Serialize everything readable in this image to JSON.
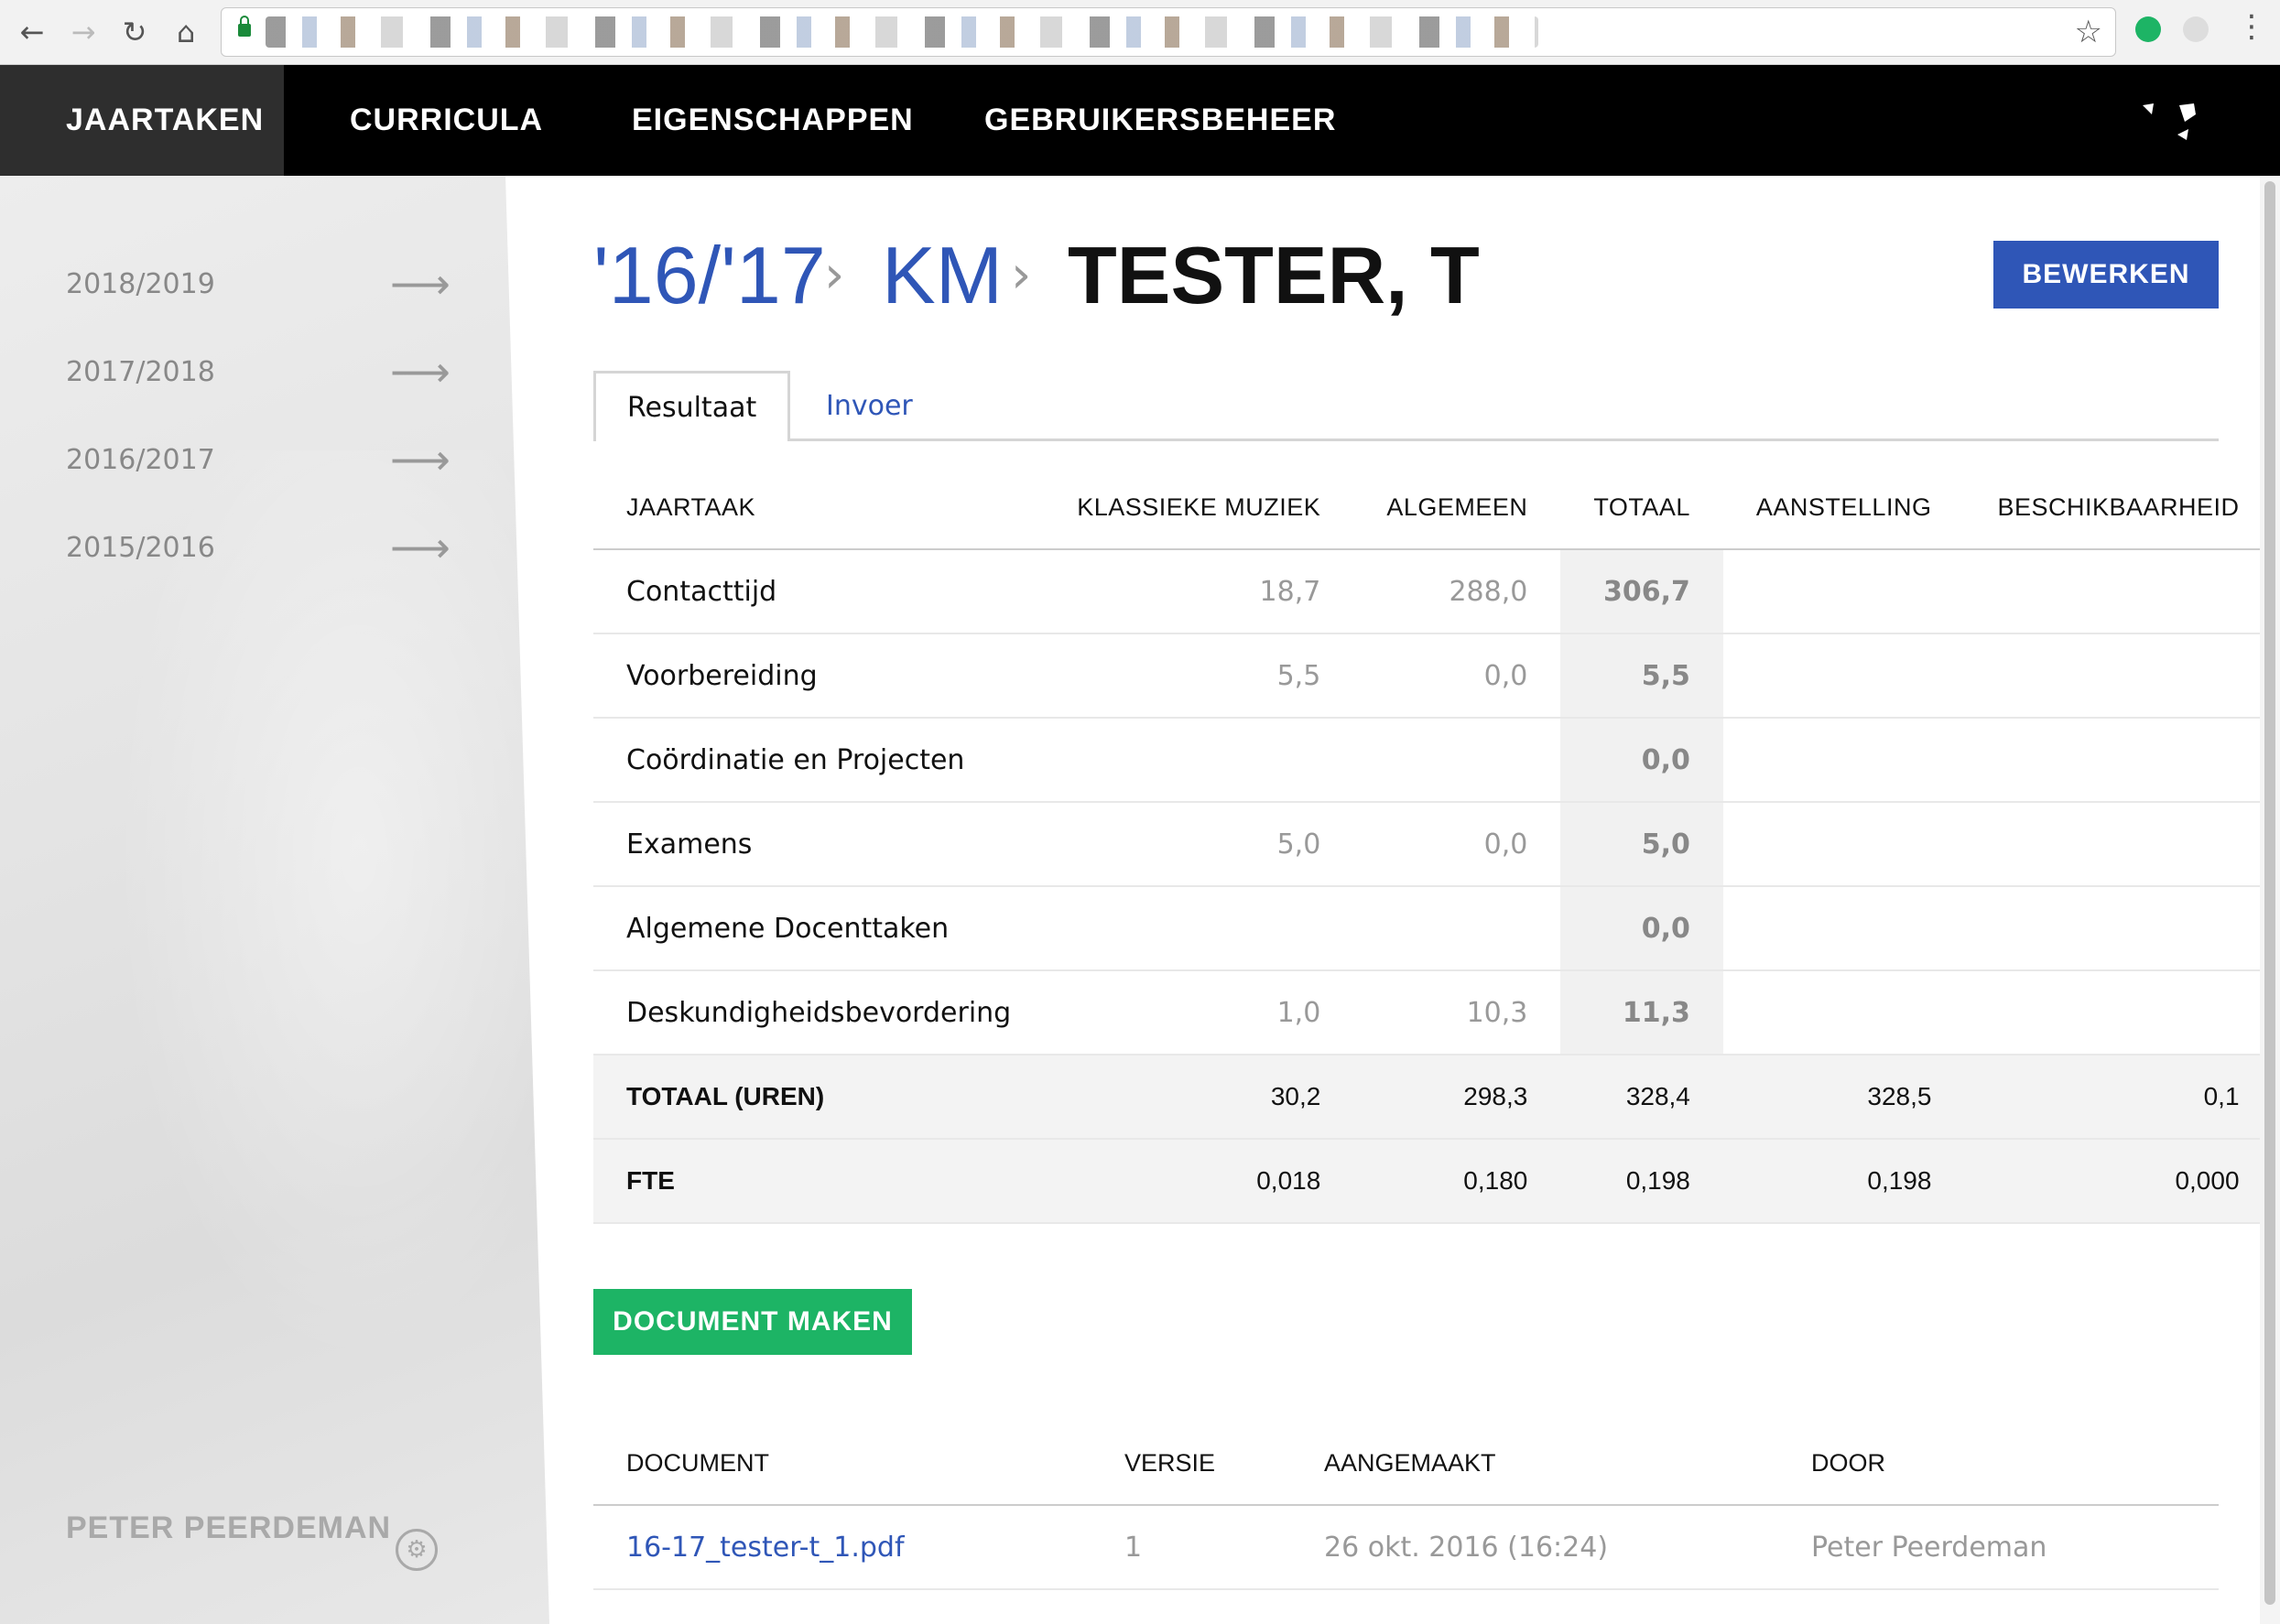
{
  "nav": {
    "tabs": [
      {
        "label": "JAARTAKEN"
      },
      {
        "label": "CURRICULA"
      },
      {
        "label": "EIGENSCHAPPEN"
      },
      {
        "label": "GEBRUIKERSBEHEER"
      }
    ]
  },
  "sidebar": {
    "years": [
      "2018/2019",
      "2017/2018",
      "2016/2017",
      "2015/2016"
    ],
    "user": "PETER PEERDEMAN"
  },
  "breadcrumb": {
    "year": "'16/'17",
    "dept": "KM",
    "name": "TESTER, T"
  },
  "edit_button": "BEWERKEN",
  "content_tabs": {
    "result": "Resultaat",
    "input": "Invoer"
  },
  "results": {
    "headers": [
      "JAARTAAK",
      "KLASSIEKE MUZIEK",
      "ALGEMEEN",
      "TOTAAL",
      "AANSTELLING",
      "BESCHIKBAARHEID"
    ],
    "rows": [
      {
        "task": "Contacttijd",
        "km": "18,7",
        "alg": "288,0",
        "tot": "306,7"
      },
      {
        "task": "Voorbereiding",
        "km": "5,5",
        "alg": "0,0",
        "tot": "5,5"
      },
      {
        "task": "Coördinatie en Projecten",
        "km": "",
        "alg": "",
        "tot": "0,0"
      },
      {
        "task": "Examens",
        "km": "5,0",
        "alg": "0,0",
        "tot": "5,0"
      },
      {
        "task": "Algemene Docenttaken",
        "km": "",
        "alg": "",
        "tot": "0,0"
      },
      {
        "task": "Deskundigheidsbevordering",
        "km": "1,0",
        "alg": "10,3",
        "tot": "11,3"
      }
    ],
    "total": {
      "label": "TOTAAL (UREN)",
      "km": "30,2",
      "alg": "298,3",
      "tot": "328,4",
      "aan": "328,5",
      "besch": "0,1"
    },
    "fte": {
      "label": "FTE",
      "km": "0,018",
      "alg": "0,180",
      "tot": "0,198",
      "aan": "0,198",
      "besch": "0,000"
    }
  },
  "doc_button": "DOCUMENT MAKEN",
  "documents": {
    "headers": [
      "DOCUMENT",
      "VERSIE",
      "AANGEMAAKT",
      "DOOR"
    ],
    "rows": [
      {
        "file": "16-17_tester-t_1.pdf",
        "version": "1",
        "created": "26 okt. 2016 (16:24)",
        "by": "Peter Peerdeman"
      }
    ]
  }
}
